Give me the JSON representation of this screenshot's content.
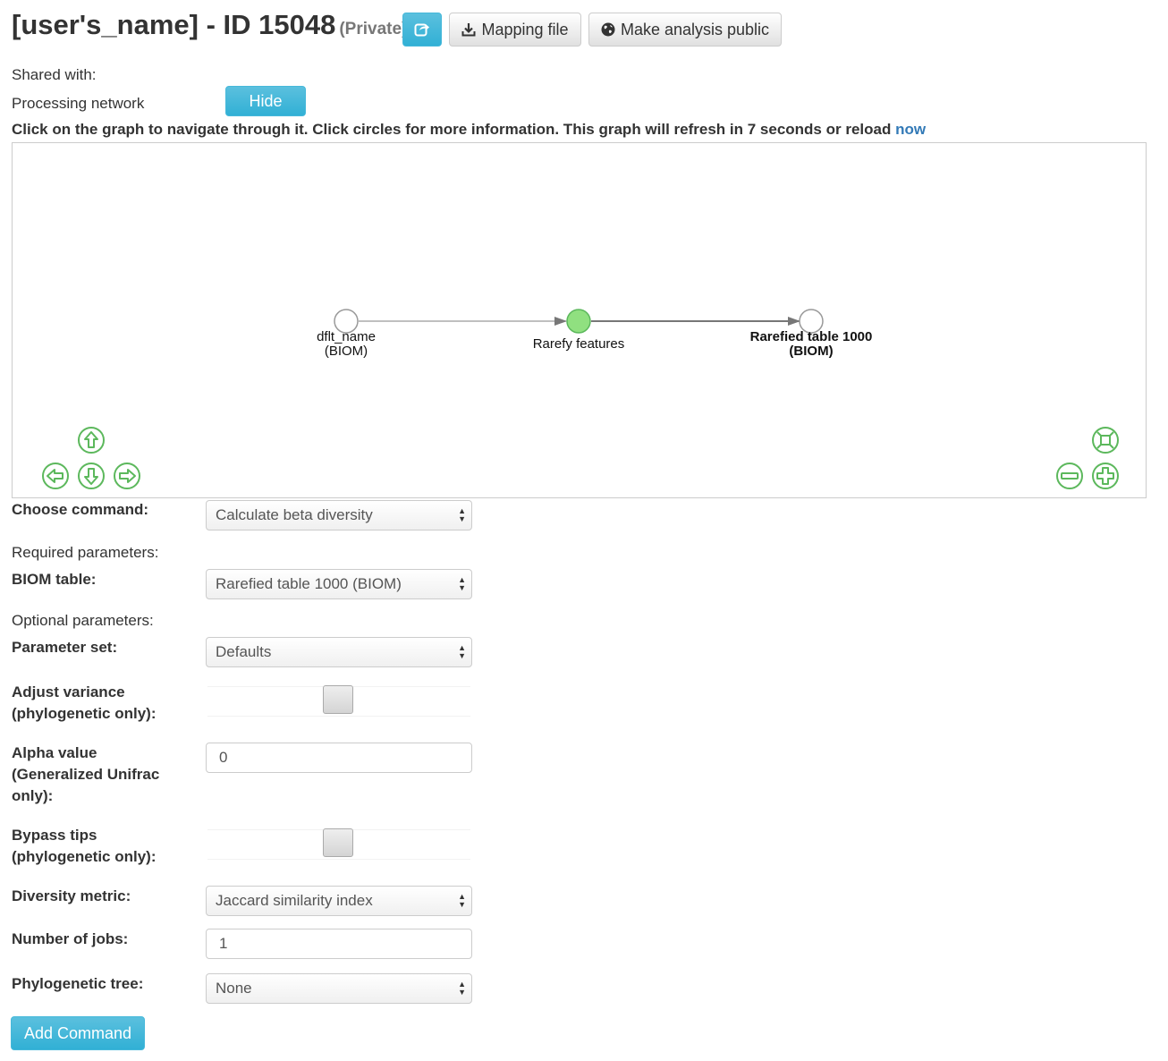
{
  "header": {
    "title": "[user's_name] - ID 15048",
    "privacy": "(Private)",
    "share_icon": "share-icon",
    "mapping_file_label": "Mapping file",
    "make_public_label": "Make analysis public"
  },
  "shared_with_label": "Shared with:",
  "processing_network": {
    "label": "Processing network",
    "hide_label": "Hide"
  },
  "notice": {
    "text": "Click on the graph to navigate through it. Click circles for more information. This graph will refresh in 7 seconds or reload",
    "link": "now"
  },
  "graph": {
    "nodes": [
      {
        "line1": "dflt_name",
        "line2": "(BIOM)",
        "color": "#ffffff",
        "bold": false
      },
      {
        "line1": "Rarefy features",
        "line2": "",
        "color": "#90e080",
        "bold": false
      },
      {
        "line1": "Rarefied table 1000",
        "line2": "(BIOM)",
        "color": "#ffffff",
        "bold": true
      }
    ],
    "nav_color": "#5cb85c",
    "nav_icons": [
      "arrow-up-icon",
      "arrow-left-icon",
      "arrow-down-icon",
      "arrow-right-icon",
      "fit-view-icon",
      "zoom-out-icon",
      "zoom-in-icon"
    ]
  },
  "form": {
    "choose_command_label": "Choose command:",
    "choose_command_value": "Calculate beta diversity",
    "required_label": "Required parameters:",
    "biom_label": "BIOM table:",
    "biom_value": "Rarefied table 1000 (BIOM)",
    "optional_label": "Optional parameters:",
    "param_set_label": "Parameter set:",
    "param_set_value": "Defaults",
    "adjust_variance_label_1": "Adjust variance",
    "adjust_variance_label_2": "(phylogenetic only):",
    "alpha_label_1": "Alpha value",
    "alpha_label_2": "(Generalized Unifrac",
    "alpha_label_3": "only):",
    "alpha_value": "0",
    "bypass_label_1": "Bypass tips",
    "bypass_label_2": "(phylogenetic only):",
    "metric_label": "Diversity metric:",
    "metric_value": "Jaccard similarity index",
    "jobs_label": "Number of jobs:",
    "jobs_value": "1",
    "tree_label": "Phylogenetic tree:",
    "tree_value": "None",
    "add_command_label": "Add Command"
  }
}
